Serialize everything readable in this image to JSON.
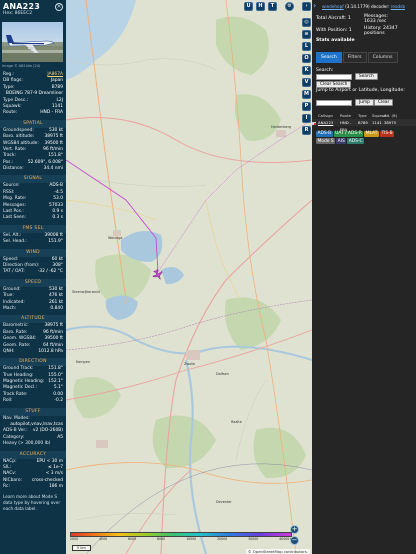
{
  "aircraft": {
    "callsign": "ANA223",
    "hex_label": "Hex: 86EEC2",
    "photo_credit": "Image © AB1ldie (24)",
    "identity": [
      {
        "k": "Reg.:",
        "v": "JA867A",
        "link": true
      },
      {
        "k": "DB flags:",
        "v": "Japan"
      },
      {
        "k": "Type:",
        "v": "B789"
      },
      {
        "k": "",
        "v": "BOEING 787-9 Dreamliner"
      },
      {
        "k": "Type Desc.:",
        "v": "L2J"
      },
      {
        "k": "Squawk:",
        "v": "1141"
      },
      {
        "k": "Route:",
        "v": "HND - FRA"
      }
    ],
    "sections": [
      {
        "title": "SPATIAL",
        "rows": [
          {
            "k": "Groundspeed:",
            "v": "530 kt"
          },
          {
            "k": "Baro. altitude:",
            "v": "38975 ft"
          },
          {
            "k": "WGS84 altitude:",
            "v": "39500 ft"
          },
          {
            "k": "Vert. Rate:",
            "v": "96 ft/min"
          },
          {
            "k": "Track:",
            "v": "151.8°"
          },
          {
            "k": "Pos.:",
            "v": "52.609°, 6.008°"
          },
          {
            "k": "Distance:",
            "v": "34.4 nmi"
          }
        ]
      },
      {
        "title": "SIGNAL",
        "rows": [
          {
            "k": "Source:",
            "v": "ADS-B"
          },
          {
            "k": "RSSI:",
            "v": "-4.5"
          },
          {
            "k": "Msg. Rate:",
            "v": "53.0"
          },
          {
            "k": "Messages:",
            "v": "57033"
          },
          {
            "k": "Last Pos.:",
            "v": "0.9 s"
          },
          {
            "k": "Last Seen:",
            "v": "0.3 s"
          }
        ]
      },
      {
        "title": "FMS SEL",
        "rows": [
          {
            "k": "Sel. Alt.:",
            "v": "39008 ft"
          },
          {
            "k": "Sel. Head.:",
            "v": "151.9°"
          }
        ]
      },
      {
        "title": "WIND",
        "rows": [
          {
            "k": "Speed:",
            "v": "60 kt"
          },
          {
            "k": "Direction (from):",
            "v": "308°"
          },
          {
            "k": "TAT / OAT:",
            "v": "-32 / -62 °C"
          }
        ]
      },
      {
        "title": "SPEED",
        "rows": [
          {
            "k": "Ground:",
            "v": "530 kt"
          },
          {
            "k": "True:",
            "v": "476 kt"
          },
          {
            "k": "Indicated:",
            "v": "261 kt"
          },
          {
            "k": "Mach:",
            "v": "0.840"
          }
        ]
      },
      {
        "title": "ALTITUDE",
        "rows": [
          {
            "k": "Barometric:",
            "v": "38975 ft"
          },
          {
            "k": "Baro. Rate:",
            "v": "96 ft/min"
          },
          {
            "k": "Geom. WGS84:",
            "v": "39500 ft"
          },
          {
            "k": "Geom. Rate:",
            "v": "64 ft/min"
          },
          {
            "k": "QNH:",
            "v": "1012.8 hPa"
          }
        ]
      },
      {
        "title": "DIRECTION",
        "rows": [
          {
            "k": "Ground Track:",
            "v": "151.8°"
          },
          {
            "k": "True Heading:",
            "v": "155.0°"
          },
          {
            "k": "Magnetic Heading:",
            "v": "152.1°"
          },
          {
            "k": "Magnetic Decl.:",
            "v": "5.1°"
          },
          {
            "k": "Track Rate:",
            "v": "0.00"
          },
          {
            "k": "Roll:",
            "v": "-0.2"
          }
        ]
      },
      {
        "title": "STUFF",
        "rows": [
          {
            "k": "Nav. Modes:",
            "v": ""
          },
          {
            "k": "",
            "v": "autopilot,vnav,lnav,tcas"
          },
          {
            "k": "ADS-B Ver.:",
            "v": "v2 (DO-260B)"
          },
          {
            "k": "Category:",
            "v": "A5"
          },
          {
            "k": "Heavy (> 300,000 lb)",
            "v": ""
          }
        ]
      },
      {
        "title": "ACCURACY",
        "rows": [
          {
            "k": "NACp:",
            "v": "EPU < 30 m"
          },
          {
            "k": "SIL:",
            "v": "≤ 1e-7"
          },
          {
            "k": "NACv:",
            "v": "< 3 m/s"
          },
          {
            "k": "NICbaro:",
            "v": "cross-checked"
          },
          {
            "k": "Rc:",
            "v": "186 m"
          }
        ]
      }
    ],
    "footer_note": "Learn more about Mode S data type by hovering over each data label."
  },
  "map": {
    "top_buttons": [
      "U",
      "H",
      "T"
    ],
    "side_buttons": [
      "L",
      "O",
      "K",
      "V",
      "M",
      "P",
      "I",
      "R"
    ],
    "cities": [
      "Wolvega",
      "Steenwijkerwold",
      "Dalfsen",
      "Zwolle",
      "Hardenberg",
      "Kampen",
      "Deventer",
      "Raalte"
    ],
    "altitude_labels": [
      "2000",
      "4000",
      "6000",
      "8000",
      "10000",
      "20000",
      "30000",
      "40000+"
    ],
    "scale": "5 km",
    "attribution": "© OpenStreetMap contributors.",
    "zoom_in": "+",
    "zoom_out": "−"
  },
  "status": {
    "version_link": "wiedehopf",
    "version_text": "(3.14.1779) decoder:",
    "readsb": "readsb",
    "total_aircraft_label": "Total Aircraft: 1",
    "with_position_label": "With Position: 1",
    "messages_label": "Messages:",
    "messages_value": "1633 /sec",
    "history_label": "History: 24347",
    "history_unit": "positions",
    "stats_label": "Stats available"
  },
  "panel": {
    "tabs": [
      "Search",
      "Filters",
      "Columns"
    ],
    "search_label": "Search:",
    "search_button": "Search",
    "clear_search_button": "Clear Search",
    "jump_label": "Jump to Airport or Latitude, Longitude:",
    "jump_button": "Jump",
    "clear_button": "Clear",
    "table_headers": [
      "",
      "Callsign",
      "Route",
      "Type",
      "Squawk",
      "Alt. (ft)"
    ],
    "table_rows": [
      {
        "callsign": "ANA223",
        "route": "HND - FRA",
        "type": "B789",
        "squawk": "1141",
        "alt": "38975"
      }
    ],
    "source_chips": [
      "ADS-B",
      "UAT / ADS-R",
      "MLAT",
      "TIS-B",
      "Mode S",
      "AIS",
      "ADS-C"
    ]
  }
}
